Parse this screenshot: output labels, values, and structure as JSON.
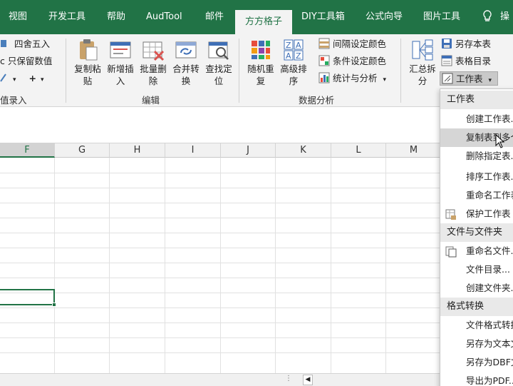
{
  "tabs": [
    {
      "label": "视图",
      "active": false
    },
    {
      "label": "开发工具",
      "active": false
    },
    {
      "label": "帮助",
      "active": false
    },
    {
      "label": "AudTool",
      "active": false
    },
    {
      "label": "邮件",
      "active": false
    },
    {
      "label": "方方格子",
      "active": true
    },
    {
      "label": "DIY工具箱",
      "active": false
    },
    {
      "label": "公式向导",
      "active": false
    },
    {
      "label": "图片工具",
      "active": false
    }
  ],
  "tab_right_icon": "lightbulb-icon",
  "tab_right_text": "操",
  "ribbon": {
    "left_small": [
      "四舍五入",
      "只保留数值",
      "+"
    ],
    "left_partial_label": "值录入",
    "left_prefix": "c",
    "edit_buttons": [
      {
        "label": "复制粘\n贴",
        "icon": "clipboard-icon"
      },
      {
        "label": "新增插\n入",
        "icon": "insert-icon"
      },
      {
        "label": "批量删\n除",
        "icon": "batch-delete-icon"
      },
      {
        "label": "合并转\n换",
        "icon": "merge-convert-icon"
      },
      {
        "label": "查找定\n位",
        "icon": "find-locate-icon"
      }
    ],
    "edit_group_label": "编辑",
    "analysis_buttons": [
      {
        "label": "随机重\n复",
        "icon": "random-icon"
      },
      {
        "label": "高级排\n序",
        "icon": "sort-az-icon"
      }
    ],
    "analysis_small": [
      {
        "label": "间隔设定颜色",
        "icon": "interval-color-icon"
      },
      {
        "label": "条件设定颜色",
        "icon": "condition-color-icon"
      },
      {
        "label": "统计与分析",
        "icon": "stats-icon"
      }
    ],
    "analysis_group_label": "数据分析",
    "summary_button": {
      "label": "汇总拆\n分",
      "icon": "summary-split-icon"
    },
    "right_small": [
      {
        "label": "另存本表",
        "icon": "save-sheet-icon"
      },
      {
        "label": "表格目录",
        "icon": "sheet-index-icon"
      },
      {
        "label": "工作表",
        "icon": "worksheet-icon"
      }
    ]
  },
  "columns": [
    "F",
    "G",
    "H",
    "I",
    "J",
    "K",
    "L",
    "M"
  ],
  "selected_column": "F",
  "menu": {
    "sections": [
      {
        "header": "工作表",
        "items": [
          {
            "label": "创建工作表...",
            "icon": ""
          },
          {
            "label": "复制表到多个",
            "icon": "",
            "hover": true
          },
          {
            "label": "删除指定表...",
            "icon": ""
          },
          {
            "label": "排序工作表...",
            "icon": ""
          },
          {
            "label": "重命名工作表",
            "icon": ""
          },
          {
            "label": "保护工作表",
            "icon": "protect-sheet-icon"
          }
        ]
      },
      {
        "header": "文件与文件夹",
        "items": [
          {
            "label": "重命名文件...",
            "icon": "rename-file-icon"
          },
          {
            "label": "文件目录...",
            "icon": ""
          },
          {
            "label": "创建文件夹...",
            "icon": ""
          }
        ]
      },
      {
        "header": "格式转换",
        "items": [
          {
            "label": "文件格式转换",
            "icon": ""
          },
          {
            "label": "另存为文本文件",
            "icon": ""
          },
          {
            "label": "另存为DBF文件",
            "icon": ""
          },
          {
            "label": "导出为PDF...",
            "icon": ""
          }
        ]
      }
    ]
  },
  "colors": {
    "accent": "#217346",
    "ribbon_bg": "#f3f3f3",
    "menu_hover": "#d6d6d6"
  }
}
